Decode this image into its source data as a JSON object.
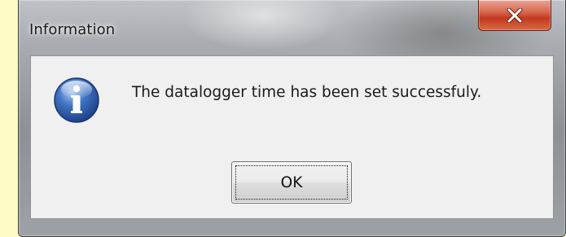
{
  "dialog": {
    "title": "Information",
    "message": "The datalogger time has been set successfuly.",
    "icon": "information-icon",
    "ok_label": "OK",
    "close_icon": "close-icon"
  },
  "colors": {
    "background": "#fdfbc6",
    "close_button": "#c23a1e",
    "info_icon_blue": "#2f5fa8",
    "client_area": "#f0f0f0"
  }
}
